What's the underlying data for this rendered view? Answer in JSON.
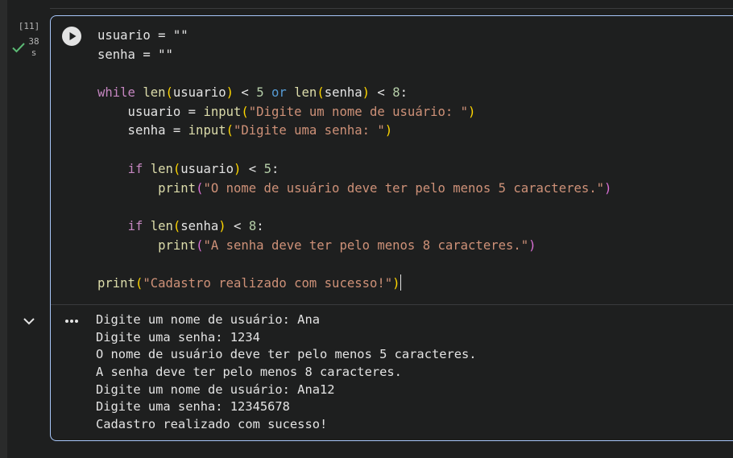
{
  "cell": {
    "execution_count": "[11]",
    "exec_time": [
      "38",
      "s"
    ],
    "status_color": "#5bb974",
    "border_color": "#a8c7fa"
  },
  "code": {
    "lines": [
      [
        {
          "t": "usuario = \"\""
        }
      ],
      [
        {
          "t": "senha = \"\""
        }
      ],
      [],
      [
        {
          "t": "while",
          "c": "kw-ctrl"
        },
        {
          "t": " "
        },
        {
          "t": "len",
          "c": "fn"
        },
        {
          "t": "(",
          "c": "br1"
        },
        {
          "t": "usuario"
        },
        {
          "t": ")",
          "c": "br1"
        },
        {
          "t": " < "
        },
        {
          "t": "5",
          "c": "num"
        },
        {
          "t": " "
        },
        {
          "t": "or",
          "c": "kw-op"
        },
        {
          "t": " "
        },
        {
          "t": "len",
          "c": "fn"
        },
        {
          "t": "(",
          "c": "br1"
        },
        {
          "t": "senha"
        },
        {
          "t": ")",
          "c": "br1"
        },
        {
          "t": " < "
        },
        {
          "t": "8",
          "c": "num"
        },
        {
          "t": ":"
        }
      ],
      [
        {
          "t": "    usuario = "
        },
        {
          "t": "input",
          "c": "fn"
        },
        {
          "t": "(",
          "c": "br1"
        },
        {
          "t": "\"Digite um nome de usuário: \"",
          "c": "str"
        },
        {
          "t": ")",
          "c": "br1"
        }
      ],
      [
        {
          "t": "    senha = "
        },
        {
          "t": "input",
          "c": "fn"
        },
        {
          "t": "(",
          "c": "br1"
        },
        {
          "t": "\"Digite uma senha: \"",
          "c": "str"
        },
        {
          "t": ")",
          "c": "br1"
        }
      ],
      [],
      [
        {
          "t": "    "
        },
        {
          "t": "if",
          "c": "kw-ctrl"
        },
        {
          "t": " "
        },
        {
          "t": "len",
          "c": "fn"
        },
        {
          "t": "(",
          "c": "br1"
        },
        {
          "t": "usuario"
        },
        {
          "t": ")",
          "c": "br1"
        },
        {
          "t": " < "
        },
        {
          "t": "5",
          "c": "num"
        },
        {
          "t": ":"
        }
      ],
      [
        {
          "t": "        "
        },
        {
          "t": "print",
          "c": "fn"
        },
        {
          "t": "(",
          "c": "br2"
        },
        {
          "t": "\"O nome de usuário deve ter pelo menos 5 caracteres.\"",
          "c": "str"
        },
        {
          "t": ")",
          "c": "br2"
        }
      ],
      [],
      [
        {
          "t": "    "
        },
        {
          "t": "if",
          "c": "kw-ctrl"
        },
        {
          "t": " "
        },
        {
          "t": "len",
          "c": "fn"
        },
        {
          "t": "(",
          "c": "br1"
        },
        {
          "t": "senha"
        },
        {
          "t": ")",
          "c": "br1"
        },
        {
          "t": " < "
        },
        {
          "t": "8",
          "c": "num"
        },
        {
          "t": ":"
        }
      ],
      [
        {
          "t": "        "
        },
        {
          "t": "print",
          "c": "fn"
        },
        {
          "t": "(",
          "c": "br2"
        },
        {
          "t": "\"A senha deve ter pelo menos 8 caracteres.\"",
          "c": "str"
        },
        {
          "t": ")",
          "c": "br2"
        }
      ],
      [],
      [
        {
          "t": "print",
          "c": "fn"
        },
        {
          "t": "(",
          "c": "br1"
        },
        {
          "t": "\"Cadastro realizado com sucesso!\"",
          "c": "str"
        },
        {
          "t": ")",
          "c": "br1"
        }
      ]
    ]
  },
  "output": {
    "lines": [
      "Digite um nome de usuário: Ana",
      "Digite uma senha: 1234",
      "O nome de usuário deve ter pelo menos 5 caracteres.",
      "A senha deve ter pelo menos 8 caracteres.",
      "Digite um nome de usuário: Ana12",
      "Digite uma senha: 12345678",
      "Cadastro realizado com sucesso!"
    ]
  }
}
